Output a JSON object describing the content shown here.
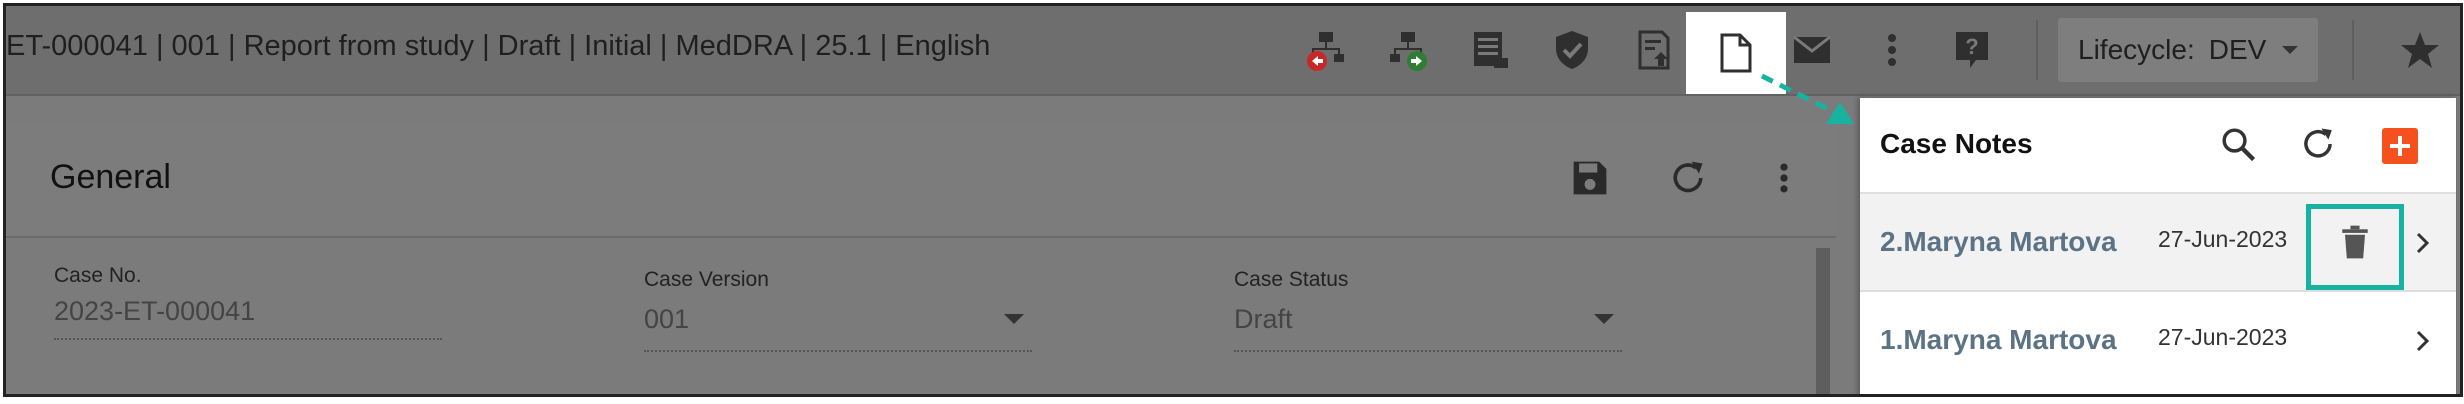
{
  "header": {
    "case_title": "ET-000041 | 001 | Report from study | Draft | Initial | MedDRA | 25.1 | English",
    "toolbar_icons": [
      "hierarchy-back-icon",
      "hierarchy-forward-icon",
      "report-list-icon",
      "shield-check-icon",
      "document-upload-icon",
      "notes-document-icon",
      "mail-icon",
      "more-vert-icon",
      "help-icon"
    ],
    "lifecycle": {
      "label": "Lifecycle:",
      "value": "DEV"
    }
  },
  "general": {
    "title": "General",
    "fields": [
      {
        "label": "Case No.",
        "value": "2023-ET-000041"
      },
      {
        "label": "Case Version",
        "value": "001"
      },
      {
        "label": "Case Status",
        "value": "Draft"
      }
    ]
  },
  "case_notes": {
    "title": "Case Notes",
    "notes": [
      {
        "author": "2.Maryna Martova",
        "date": "27-Jun-2023"
      },
      {
        "author": "1.Maryna Martova",
        "date": "27-Jun-2023"
      }
    ]
  },
  "colors": {
    "accent_add": "#f4511e",
    "highlight": "#17b3a0",
    "author_text": "#5c7285"
  }
}
